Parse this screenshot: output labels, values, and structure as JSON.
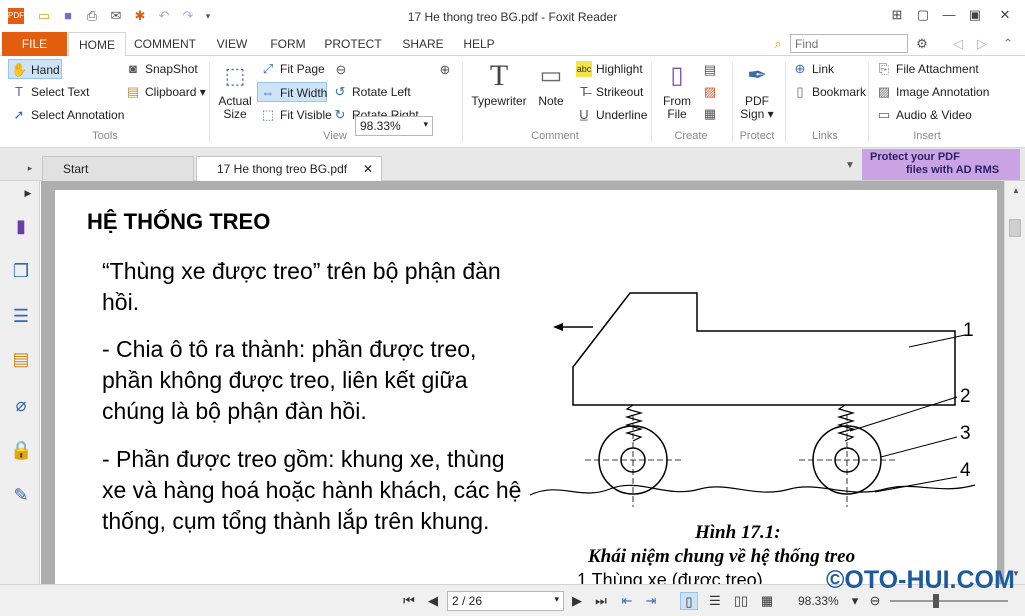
{
  "window": {
    "title": "17 He thong treo BG.pdf - Foxit Reader",
    "quick_access_icons": [
      "app-logo-icon",
      "open-icon",
      "save-icon",
      "print-icon",
      "email-icon",
      "new-icon",
      "undo-icon",
      "redo-icon",
      "customize-icon"
    ]
  },
  "ribbon_tabs": [
    "FILE",
    "HOME",
    "COMMENT",
    "VIEW",
    "FORM",
    "PROTECT",
    "SHARE",
    "HELP"
  ],
  "active_tab": "HOME",
  "search": {
    "placeholder": "Find"
  },
  "ribbon": {
    "tools": {
      "hand": "Hand",
      "select_text": "Select Text",
      "select_annotation": "Select Annotation",
      "snapshot": "SnapShot",
      "clipboard": "Clipboard",
      "group": "Tools"
    },
    "view": {
      "actual_size_1": "Actual",
      "actual_size_2": "Size",
      "fit_page": "Fit Page",
      "fit_width": "Fit Width",
      "fit_visible": "Fit Visible",
      "zoom_value": "98.33%",
      "rotate_left": "Rotate Left",
      "rotate_right": "Rotate Right",
      "group": "View"
    },
    "comment": {
      "typewriter": "Typewriter",
      "note": "Note",
      "highlight": "Highlight",
      "strikeout": "Strikeout",
      "underline": "Underline",
      "group": "Comment"
    },
    "create": {
      "from_file_1": "From",
      "from_file_2": "File",
      "group": "Create"
    },
    "protect": {
      "pdf_sign_1": "PDF",
      "pdf_sign_2": "Sign",
      "group": "Protect"
    },
    "links": {
      "link": "Link",
      "bookmark": "Bookmark",
      "group": "Links"
    },
    "insert": {
      "file_attachment": "File Attachment",
      "image_annotation": "Image Annotation",
      "audio_video": "Audio & Video",
      "group": "Insert"
    }
  },
  "doc_tabs": [
    "Start",
    "17 He thong treo BG.pdf"
  ],
  "ad_banner": {
    "line1": "Protect your PDF",
    "line2": "files with AD RMS"
  },
  "document": {
    "heading": "HỆ THỐNG TREO",
    "para1": "“Thùng xe được treo” trên bộ phận đàn hồi.",
    "para2": "- Chia ô tô ra thành: phần được treo, phần không được treo, liên kết giữa chúng là bộ phận đàn hồi.",
    "para3": "- Phần được treo gồm: khung xe, thùng xe và hàng hoá hoặc hành khách, các hệ thống, cụm tổng thành lắp trên khung.",
    "figure_labels": [
      "1",
      "2",
      "3",
      "4"
    ],
    "caption_title": "Hình 17.1:",
    "caption_sub": "Khái niệm chung về hệ thống treo",
    "caption_partial": "1 Thùng xe (được treo)"
  },
  "status": {
    "page_indicator": "2 / 26",
    "zoom": "98.33%",
    "zoom_level_fraction": 0.39
  },
  "watermark": "©OTO-HUI.COM",
  "colors": {
    "file_tab": "#e35d0f",
    "accent_blue": "#3a6db0",
    "ad_banner": "#c9a3e3",
    "page_bg": "#aeaeae"
  }
}
